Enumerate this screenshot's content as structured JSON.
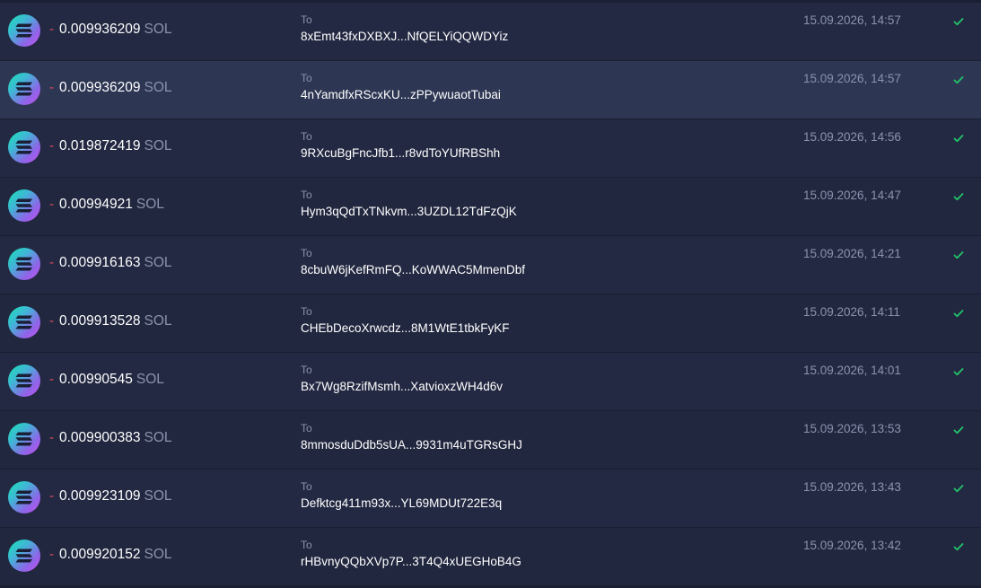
{
  "colors": {
    "page_bg": "#1a1f33",
    "row_bg": "#232942",
    "row_hover_bg": "#2d3653",
    "negative_sign": "#e14b5f",
    "muted_text": "#8a93ad",
    "success_check": "#21c46a"
  },
  "hovered_row": 1,
  "transactions": [
    {
      "sign": "-",
      "amount": "0.009936209",
      "unit": "SOL",
      "to_label": "To",
      "address": "8xEmt43fxDXBXJ...NfQELYiQQWDYiz",
      "datetime": "15.09.2026, 14:57",
      "icon": "solana-token-icon",
      "status_icon": "check-icon"
    },
    {
      "sign": "-",
      "amount": "0.009936209",
      "unit": "SOL",
      "to_label": "To",
      "address": "4nYamdfxRScxKU...zPPywuaotTubai",
      "datetime": "15.09.2026, 14:57",
      "icon": "solana-token-icon",
      "status_icon": "check-icon"
    },
    {
      "sign": "-",
      "amount": "0.019872419",
      "unit": "SOL",
      "to_label": "To",
      "address": "9RXcuBgFncJfb1...r8vdToYUfRBShh",
      "datetime": "15.09.2026, 14:56",
      "icon": "solana-token-icon",
      "status_icon": "check-icon"
    },
    {
      "sign": "-",
      "amount": "0.00994921",
      "unit": "SOL",
      "to_label": "To",
      "address": "Hym3qQdTxTNkvm...3UZDL12TdFzQjK",
      "datetime": "15.09.2026, 14:47",
      "icon": "solana-token-icon",
      "status_icon": "check-icon"
    },
    {
      "sign": "-",
      "amount": "0.009916163",
      "unit": "SOL",
      "to_label": "To",
      "address": "8cbuW6jKefRmFQ...KoWWAC5MmenDbf",
      "datetime": "15.09.2026, 14:21",
      "icon": "solana-token-icon",
      "status_icon": "check-icon"
    },
    {
      "sign": "-",
      "amount": "0.009913528",
      "unit": "SOL",
      "to_label": "To",
      "address": "CHEbDecoXrwcdz...8M1WtE1tbkFyKF",
      "datetime": "15.09.2026, 14:11",
      "icon": "solana-token-icon",
      "status_icon": "check-icon"
    },
    {
      "sign": "-",
      "amount": "0.00990545",
      "unit": "SOL",
      "to_label": "To",
      "address": "Bx7Wg8RzifMsmh...XatvioxzWH4d6v",
      "datetime": "15.09.2026, 14:01",
      "icon": "solana-token-icon",
      "status_icon": "check-icon"
    },
    {
      "sign": "-",
      "amount": "0.009900383",
      "unit": "SOL",
      "to_label": "To",
      "address": "8mmosduDdb5sUA...9931m4uTGRsGHJ",
      "datetime": "15.09.2026, 13:53",
      "icon": "solana-token-icon",
      "status_icon": "check-icon"
    },
    {
      "sign": "-",
      "amount": "0.009923109",
      "unit": "SOL",
      "to_label": "To",
      "address": "Defktcg411m93x...YL69MDUt722E3q",
      "datetime": "15.09.2026, 13:43",
      "icon": "solana-token-icon",
      "status_icon": "check-icon"
    },
    {
      "sign": "-",
      "amount": "0.009920152",
      "unit": "SOL",
      "to_label": "To",
      "address": "rHBvnyQQbXVp7P...3T4Q4xUEGHoB4G",
      "datetime": "15.09.2026, 13:42",
      "icon": "solana-token-icon",
      "status_icon": "check-icon"
    }
  ]
}
